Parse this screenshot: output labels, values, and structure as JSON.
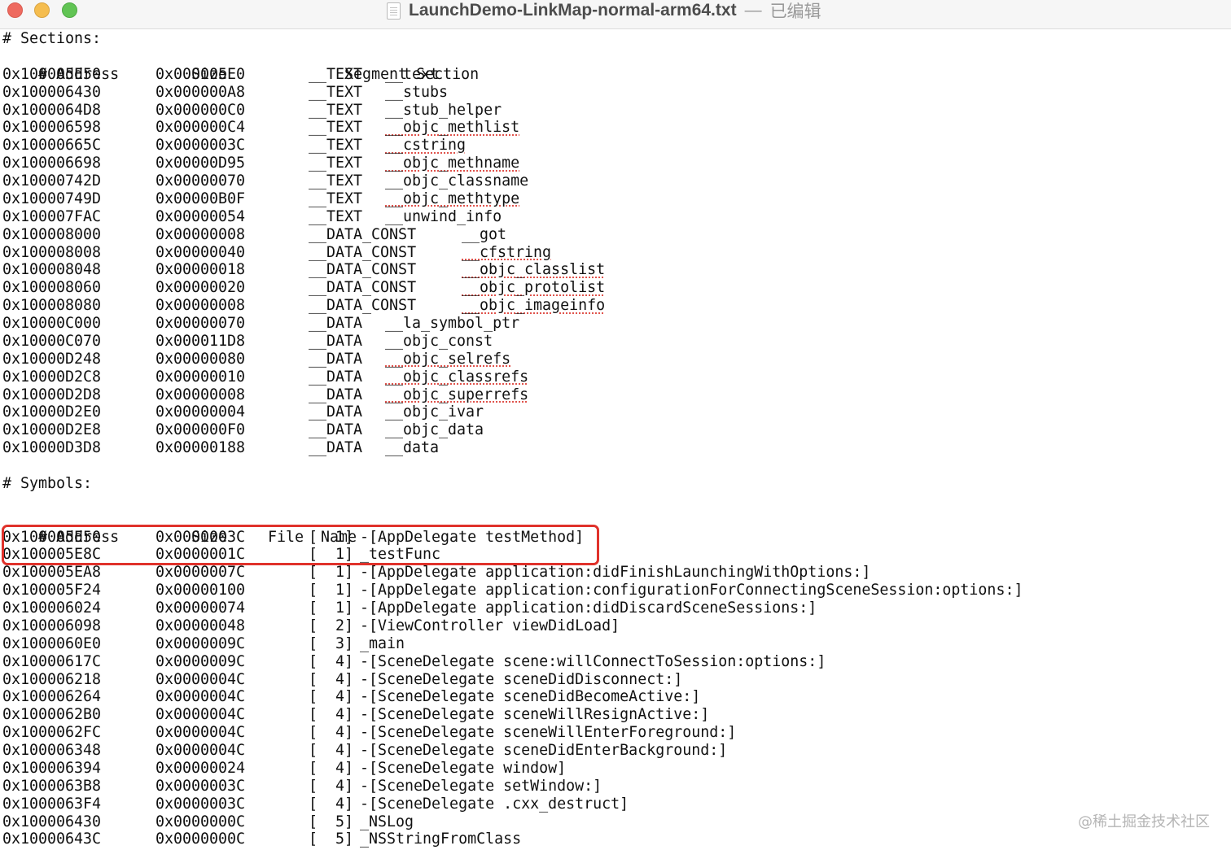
{
  "window": {
    "title": "LaunchDemo-LinkMap-normal-arm64.txt",
    "separator": "—",
    "status": "已编辑"
  },
  "sections": {
    "heading": "# Sections:",
    "columns": {
      "address": "# Address",
      "size": "Size",
      "segment": "Segment",
      "section": "Section"
    },
    "rows": [
      {
        "address": "0x100005E50",
        "size": "0x000005E0",
        "segment": "__TEXT",
        "section": "__text",
        "spell": false
      },
      {
        "address": "0x100006430",
        "size": "0x000000A8",
        "segment": "__TEXT",
        "section": "__stubs",
        "spell": false
      },
      {
        "address": "0x1000064D8",
        "size": "0x000000C0",
        "segment": "__TEXT",
        "section": "__stub_helper",
        "spell": false
      },
      {
        "address": "0x100006598",
        "size": "0x000000C4",
        "segment": "__TEXT",
        "section": "__objc_methlist",
        "spell": true
      },
      {
        "address": "0x10000665C",
        "size": "0x0000003C",
        "segment": "__TEXT",
        "section": "__cstring",
        "spell": true
      },
      {
        "address": "0x100006698",
        "size": "0x00000D95",
        "segment": "__TEXT",
        "section": "__objc_methname",
        "spell": true
      },
      {
        "address": "0x10000742D",
        "size": "0x00000070",
        "segment": "__TEXT",
        "section": "__objc_classname",
        "spell": false
      },
      {
        "address": "0x10000749D",
        "size": "0x00000B0F",
        "segment": "__TEXT",
        "section": "__objc_methtype",
        "spell": true
      },
      {
        "address": "0x100007FAC",
        "size": "0x00000054",
        "segment": "__TEXT",
        "section": "__unwind_info",
        "spell": false
      },
      {
        "address": "0x100008000",
        "size": "0x00000008",
        "segment": "__DATA_CONST",
        "section": "__got",
        "spell": false
      },
      {
        "address": "0x100008008",
        "size": "0x00000040",
        "segment": "__DATA_CONST",
        "section": "__cfstring",
        "spell": true
      },
      {
        "address": "0x100008048",
        "size": "0x00000018",
        "segment": "__DATA_CONST",
        "section": "__objc_classlist",
        "spell": true
      },
      {
        "address": "0x100008060",
        "size": "0x00000020",
        "segment": "__DATA_CONST",
        "section": "__objc_protolist",
        "spell": true
      },
      {
        "address": "0x100008080",
        "size": "0x00000008",
        "segment": "__DATA_CONST",
        "section": "__objc_imageinfo",
        "spell": true
      },
      {
        "address": "0x10000C000",
        "size": "0x00000070",
        "segment": "__DATA",
        "section": "__la_symbol_ptr",
        "spell": false
      },
      {
        "address": "0x10000C070",
        "size": "0x000011D8",
        "segment": "__DATA",
        "section": "__objc_const",
        "spell": false
      },
      {
        "address": "0x10000D248",
        "size": "0x00000080",
        "segment": "__DATA",
        "section": "__objc_selrefs",
        "spell": true
      },
      {
        "address": "0x10000D2C8",
        "size": "0x00000010",
        "segment": "__DATA",
        "section": "__objc_classrefs",
        "spell": true
      },
      {
        "address": "0x10000D2D8",
        "size": "0x00000008",
        "segment": "__DATA",
        "section": "__objc_superrefs",
        "spell": true
      },
      {
        "address": "0x10000D2E0",
        "size": "0x00000004",
        "segment": "__DATA",
        "section": "__objc_ivar",
        "spell": false
      },
      {
        "address": "0x10000D2E8",
        "size": "0x000000F0",
        "segment": "__DATA",
        "section": "__objc_data",
        "spell": false
      },
      {
        "address": "0x10000D3D8",
        "size": "0x00000188",
        "segment": "__DATA",
        "section": "__data",
        "spell": false
      }
    ]
  },
  "symbols": {
    "heading": "# Symbols:",
    "columns": {
      "address": "# Address",
      "size": "Size",
      "file": "File",
      "name": "Name"
    },
    "rows": [
      {
        "address": "0x100005E50",
        "size": "0x0000003C",
        "file": "[  1]",
        "name": "-[AppDelegate testMethod]"
      },
      {
        "address": "0x100005E8C",
        "size": "0x0000001C",
        "file": "[  1]",
        "name": "_testFunc"
      },
      {
        "address": "0x100005EA8",
        "size": "0x0000007C",
        "file": "[  1]",
        "name": "-[AppDelegate application:didFinishLaunchingWithOptions:]"
      },
      {
        "address": "0x100005F24",
        "size": "0x00000100",
        "file": "[  1]",
        "name": "-[AppDelegate application:configurationForConnectingSceneSession:options:]"
      },
      {
        "address": "0x100006024",
        "size": "0x00000074",
        "file": "[  1]",
        "name": "-[AppDelegate application:didDiscardSceneSessions:]"
      },
      {
        "address": "0x100006098",
        "size": "0x00000048",
        "file": "[  2]",
        "name": "-[ViewController viewDidLoad]"
      },
      {
        "address": "0x1000060E0",
        "size": "0x0000009C",
        "file": "[  3]",
        "name": "_main"
      },
      {
        "address": "0x10000617C",
        "size": "0x0000009C",
        "file": "[  4]",
        "name": "-[SceneDelegate scene:willConnectToSession:options:]"
      },
      {
        "address": "0x100006218",
        "size": "0x0000004C",
        "file": "[  4]",
        "name": "-[SceneDelegate sceneDidDisconnect:]"
      },
      {
        "address": "0x100006264",
        "size": "0x0000004C",
        "file": "[  4]",
        "name": "-[SceneDelegate sceneDidBecomeActive:]"
      },
      {
        "address": "0x1000062B0",
        "size": "0x0000004C",
        "file": "[  4]",
        "name": "-[SceneDelegate sceneWillResignActive:]"
      },
      {
        "address": "0x1000062FC",
        "size": "0x0000004C",
        "file": "[  4]",
        "name": "-[SceneDelegate sceneWillEnterForeground:]"
      },
      {
        "address": "0x100006348",
        "size": "0x0000004C",
        "file": "[  4]",
        "name": "-[SceneDelegate sceneDidEnterBackground:]"
      },
      {
        "address": "0x100006394",
        "size": "0x00000024",
        "file": "[  4]",
        "name": "-[SceneDelegate window]"
      },
      {
        "address": "0x1000063B8",
        "size": "0x0000003C",
        "file": "[  4]",
        "name": "-[SceneDelegate setWindow:]"
      },
      {
        "address": "0x1000063F4",
        "size": "0x0000003C",
        "file": "[  4]",
        "name": "-[SceneDelegate .cxx_destruct]"
      },
      {
        "address": "0x100006430",
        "size": "0x0000000C",
        "file": "[  5]",
        "name": "_NSLog"
      },
      {
        "address": "0x10000643C",
        "size": "0x0000000C",
        "file": "[  5]",
        "name": "_NSStringFromClass"
      }
    ]
  },
  "watermark": "@稀土掘金技术社区",
  "colors": {
    "highlight": "#e0322b",
    "spellcheck": "#e0534c"
  }
}
